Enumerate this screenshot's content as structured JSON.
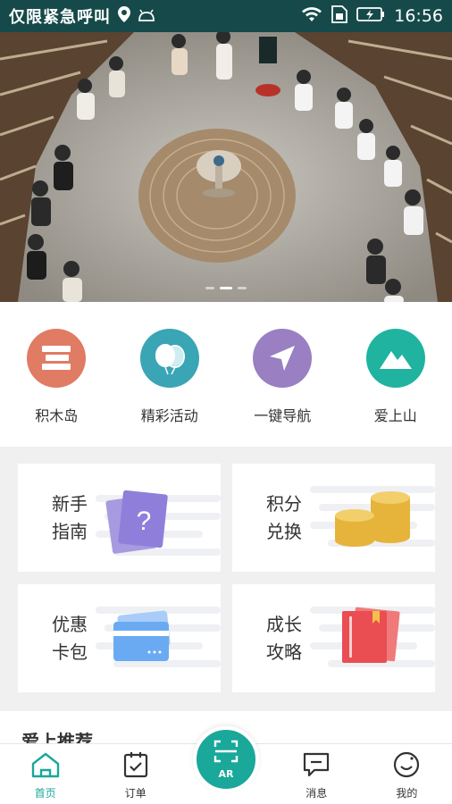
{
  "status_bar": {
    "carrier": "仅限紧急呼叫",
    "time": "16:56",
    "icons": [
      "location-icon",
      "android-icon",
      "wifi-icon",
      "sim-icon",
      "battery-icon"
    ]
  },
  "banner": {
    "slide_count": 3,
    "active_slide": 1
  },
  "quick_nav": [
    {
      "label": "积木岛",
      "icon": "blocks-icon",
      "color": "#e07b64"
    },
    {
      "label": "精彩活动",
      "icon": "balloons-icon",
      "color": "#3aa5b4"
    },
    {
      "label": "一键导航",
      "icon": "navigation-arrow-icon",
      "color": "#9a7fc2"
    },
    {
      "label": "爱上山",
      "icon": "mountain-icon",
      "color": "#1fb3a0"
    }
  ],
  "cards": [
    {
      "line1": "新手",
      "line2": "指南",
      "icon": "guide-question-icon"
    },
    {
      "line1": "积分",
      "line2": "兑换",
      "icon": "coins-icon"
    },
    {
      "line1": "优惠",
      "line2": "卡包",
      "icon": "card-icon"
    },
    {
      "line1": "成长",
      "line2": "攻略",
      "icon": "book-icon"
    }
  ],
  "recommend": {
    "title": "爱上推荐"
  },
  "tabs": [
    {
      "label": "首页",
      "icon": "home-icon",
      "active": true
    },
    {
      "label": "订单",
      "icon": "order-icon",
      "active": false
    },
    {
      "label": "AR",
      "icon": "ar-scan-icon",
      "active": false
    },
    {
      "label": "消息",
      "icon": "message-icon",
      "active": false
    },
    {
      "label": "我的",
      "icon": "profile-icon",
      "active": false
    }
  ],
  "colors": {
    "status_bar": "#164a4a",
    "accent": "#19a89a"
  }
}
